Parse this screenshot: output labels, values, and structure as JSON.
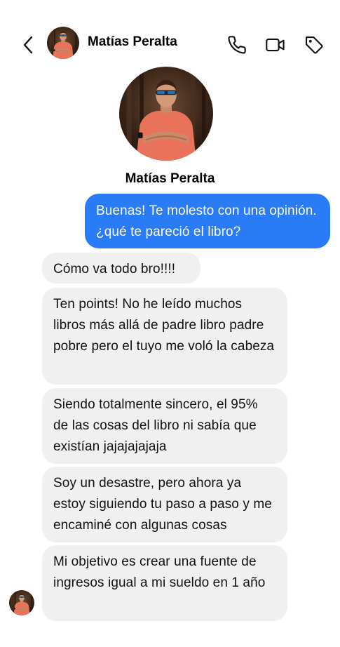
{
  "header": {
    "contact_name": "Matías Peralta",
    "back_icon": "chevron-left-icon",
    "call_icon": "phone-icon",
    "video_icon": "video-camera-icon",
    "tag_icon": "tag-icon"
  },
  "profile": {
    "name": "Matías Peralta"
  },
  "messages": [
    {
      "direction": "outgoing",
      "text": "Buenas! Te molesto con una opinión. ¿qué te pareció el libro?"
    },
    {
      "direction": "incoming",
      "text": "Cómo va todo bro!!!!"
    },
    {
      "direction": "incoming",
      "text": "Ten points! No he leído muchos libros más allá de padre libro padre pobre pero el tuyo me voló la cabeza"
    },
    {
      "direction": "incoming",
      "text": "Siendo totalmente sincero, el 95% de las cosas del libro ni sabía que existían jajajajajaja"
    },
    {
      "direction": "incoming",
      "text": "Soy un desastre, pero ahora ya estoy siguiendo tu paso a paso y me encaminé con algunas cosas"
    },
    {
      "direction": "incoming",
      "text": "Mi objetivo es crear una fuente de ingresos igual a mi sueldo en 1 año"
    }
  ],
  "colors": {
    "outgoing_bubble": "#2a7cf6",
    "incoming_bubble": "#f0f0f0",
    "avatar_shirt": "#e8735a",
    "avatar_background": "#3a2418"
  }
}
